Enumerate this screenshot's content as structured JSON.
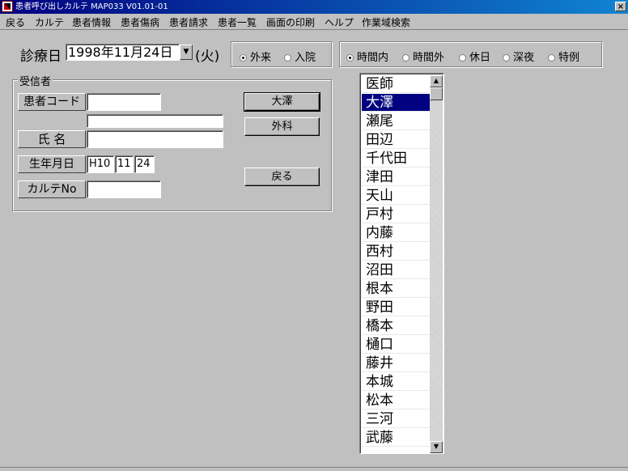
{
  "window": {
    "title": "患者呼び出しカルテ MAP033  V01.01-01",
    "close_label": "×"
  },
  "menu": [
    "戻る",
    "カルテ",
    "患者情報",
    "患者傷病",
    "患者請求",
    "患者一覧",
    "画面の印刷",
    "ヘルプ",
    "作業域検索"
  ],
  "exam_date": {
    "label": "診療日",
    "value": "1998年11月24日",
    "weekday": "(火)",
    "dropdown_icon": "chevron-down-icon"
  },
  "visit_type": {
    "options": [
      "外来",
      "入院"
    ],
    "selected": "外来"
  },
  "time_type": {
    "options": [
      "時間内",
      "時間外",
      "休日",
      "深夜",
      "特例"
    ],
    "selected": "時間内"
  },
  "receiver": {
    "group_label": "受信者",
    "patient_code_label": "患者コード",
    "patient_code_value": "",
    "kana_value": "",
    "name_label": "氏 名",
    "name_value": "",
    "birth_label": "生年月日",
    "birth_era": "H10",
    "birth_month": "11",
    "birth_day": "24",
    "chart_no_label": "カルテNo",
    "chart_no_value": ""
  },
  "buttons": {
    "doctor": "大澤",
    "department": "外科",
    "back": "戻る"
  },
  "doctor_list": {
    "header": "医師",
    "items": [
      "大澤",
      "瀬尾",
      "田辺",
      "千代田",
      "津田",
      "天山",
      "戸村",
      "内藤",
      "西村",
      "沼田",
      "根本",
      "野田",
      "橋本",
      "樋口",
      "藤井",
      "本城",
      "松本",
      "三河",
      "武藤"
    ],
    "selected_index": 0
  }
}
